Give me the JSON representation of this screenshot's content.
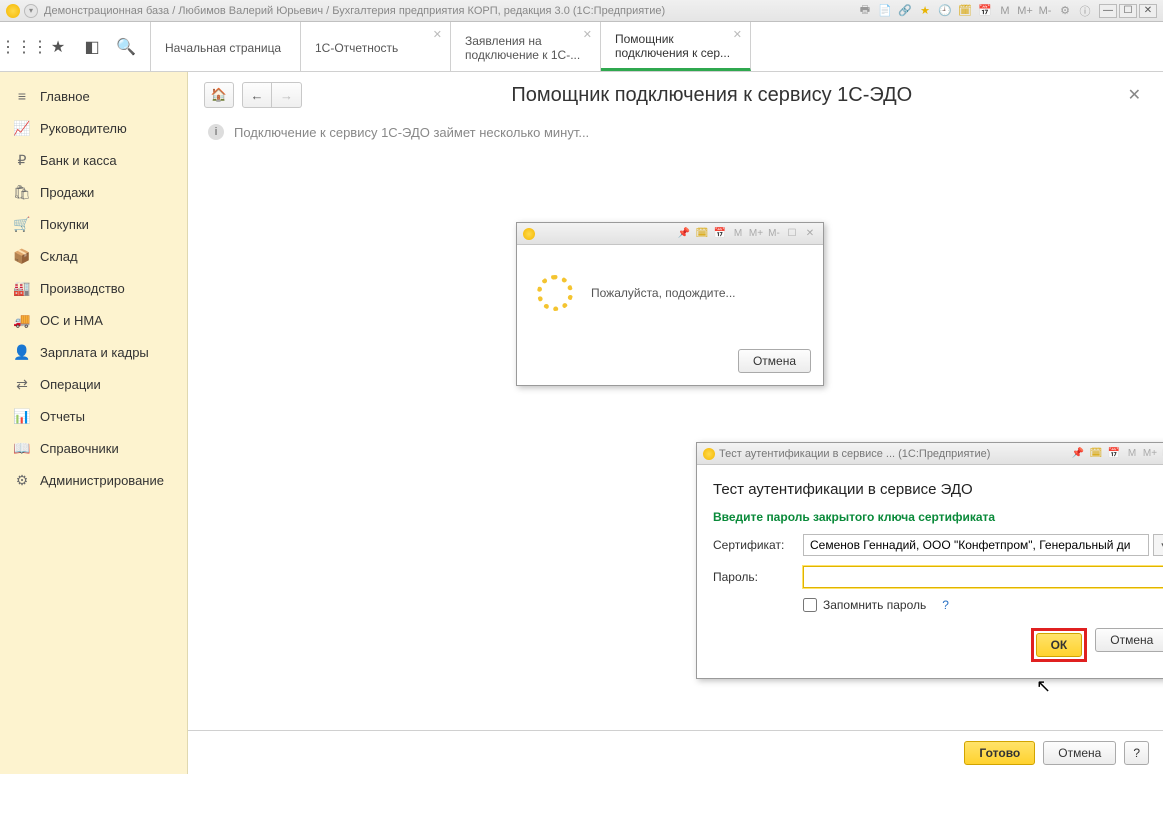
{
  "titlebar": {
    "title": "Демонстрационная база / Любимов Валерий Юрьевич / Бухгалтерия предприятия КОРП, редакция 3.0  (1С:Предприятие)"
  },
  "tabs": {
    "t0": "Начальная страница",
    "t1": "1С-Отчетность",
    "t2a": "Заявления на",
    "t2b": "подключение к 1С-...",
    "t3a": "Помощник",
    "t3b": "подключения к сер..."
  },
  "sidebar": {
    "items": [
      {
        "label": "Главное",
        "icon": "≡"
      },
      {
        "label": "Руководителю",
        "icon": "📈"
      },
      {
        "label": "Банк и касса",
        "icon": "₽"
      },
      {
        "label": "Продажи",
        "icon": "🛍"
      },
      {
        "label": "Покупки",
        "icon": "🛒"
      },
      {
        "label": "Склад",
        "icon": "📦"
      },
      {
        "label": "Производство",
        "icon": "🏭"
      },
      {
        "label": "ОС и НМА",
        "icon": "🚚"
      },
      {
        "label": "Зарплата и кадры",
        "icon": "👤"
      },
      {
        "label": "Операции",
        "icon": "⇄"
      },
      {
        "label": "Отчеты",
        "icon": "📊"
      },
      {
        "label": "Справочники",
        "icon": "📖"
      },
      {
        "label": "Администрирование",
        "icon": "⚙"
      }
    ]
  },
  "page": {
    "title": "Помощник подключения к сервису 1С-ЭДО",
    "info": "Подключение к сервису 1С-ЭДО займет несколько минут..."
  },
  "wait": {
    "text": "Пожалуйста, подождите...",
    "cancel": "Отмена"
  },
  "auth": {
    "winTitle": "Тест аутентификации в сервисе ...  (1С:Предприятие)",
    "heading": "Тест аутентификации в сервисе ЭДО",
    "sub": "Введите пароль закрытого ключа сертификата",
    "certLabel": "Сертификат:",
    "certValue": "Семенов Геннадий, ООО \"Конфетпром\", Генеральный ди",
    "pwdLabel": "Пароль:",
    "remember": "Запомнить пароль",
    "ok": "ОК",
    "cancel": "Отмена",
    "help": "?"
  },
  "footer": {
    "done": "Готово",
    "cancel": "Отмена",
    "help": "?"
  }
}
